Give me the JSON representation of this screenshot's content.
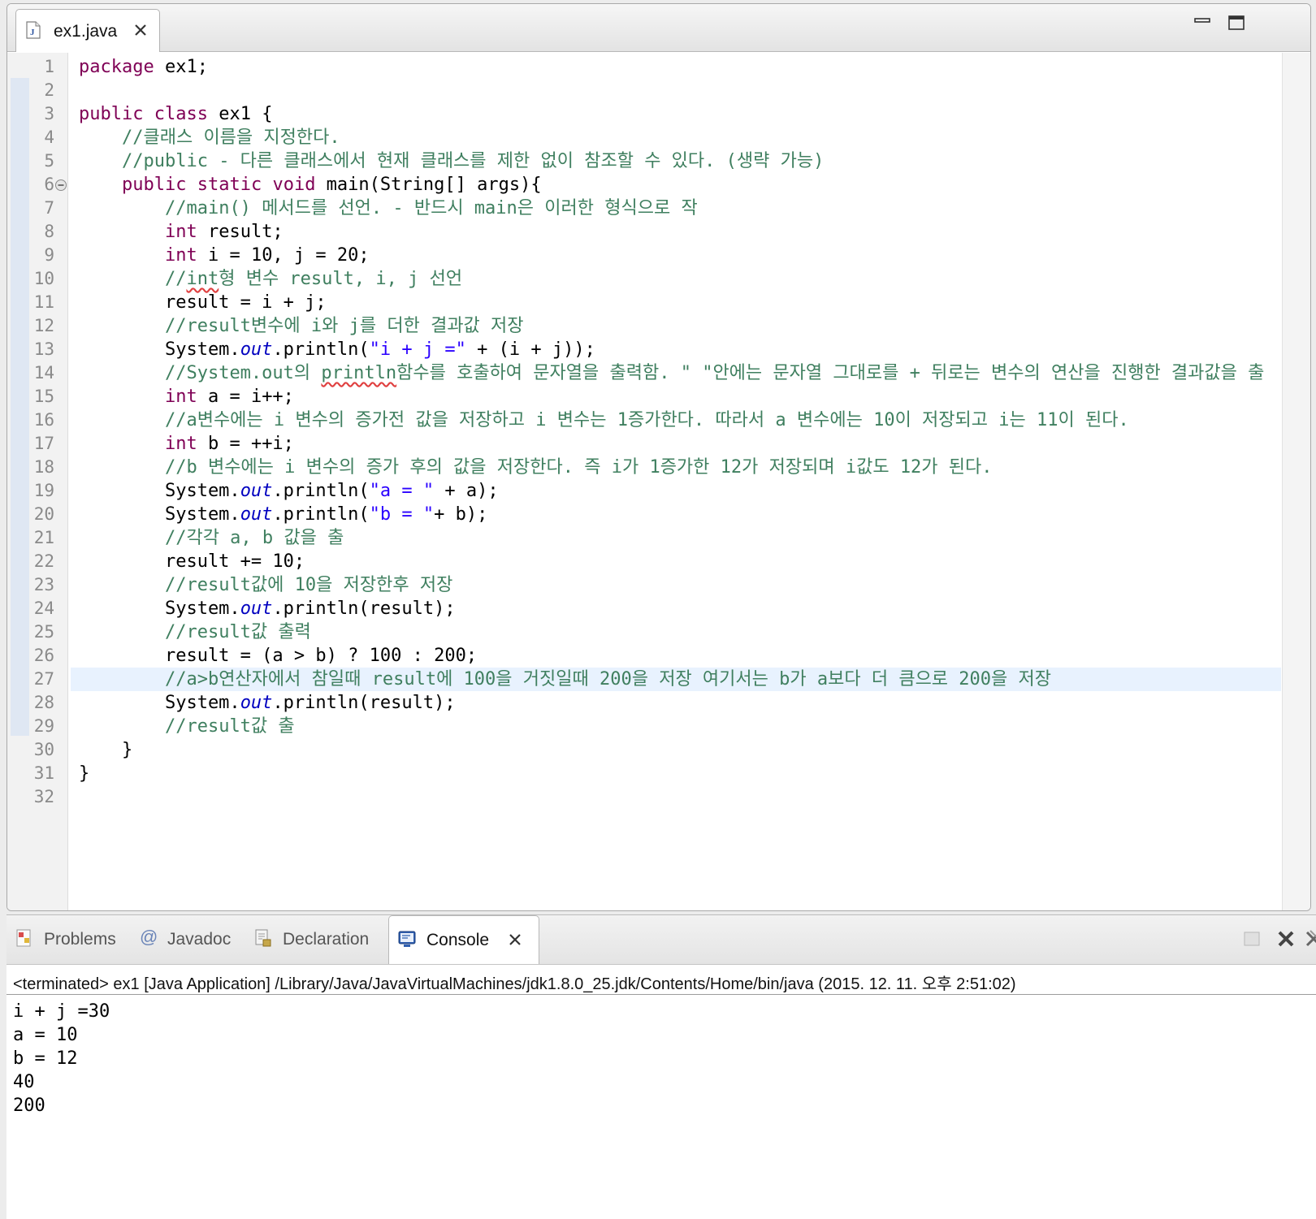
{
  "editor": {
    "tab": {
      "label": "ex1.java",
      "icon": "java-file-icon",
      "close_icon": "close-icon"
    },
    "window_controls": [
      "minimize-icon",
      "maximize-icon"
    ],
    "current_line": 27,
    "lines": [
      {
        "n": "1",
        "tokens": [
          {
            "t": "package",
            "c": "kw"
          },
          {
            "t": " ex1;"
          }
        ]
      },
      {
        "n": "2",
        "tokens": []
      },
      {
        "n": "3",
        "tokens": [
          {
            "t": "public",
            "c": "kw"
          },
          {
            "t": " "
          },
          {
            "t": "class",
            "c": "kw"
          },
          {
            "t": " ex1 {"
          }
        ]
      },
      {
        "n": "4",
        "tokens": [
          {
            "t": "    "
          },
          {
            "t": "//클래스 이름을 지정한다.",
            "c": "cm"
          }
        ]
      },
      {
        "n": "5",
        "tokens": [
          {
            "t": "    "
          },
          {
            "t": "//public - 다른 클래스에서 현재 클래스를 제한 없이 참조할 수 있다. (생략 가능)",
            "c": "cm"
          }
        ]
      },
      {
        "n": "6",
        "tokens": [
          {
            "t": "    "
          },
          {
            "t": "public",
            "c": "kw"
          },
          {
            "t": " "
          },
          {
            "t": "static",
            "c": "kw"
          },
          {
            "t": " "
          },
          {
            "t": "void",
            "c": "kw"
          },
          {
            "t": " main(String[] args){"
          }
        ]
      },
      {
        "n": "7",
        "tokens": [
          {
            "t": "        "
          },
          {
            "t": "//main() 메서드를 선언. - 반드시 main은 이러한 형식으로 작",
            "c": "cm"
          }
        ]
      },
      {
        "n": "8",
        "tokens": [
          {
            "t": "        "
          },
          {
            "t": "int",
            "c": "kw"
          },
          {
            "t": " result;"
          }
        ]
      },
      {
        "n": "9",
        "tokens": [
          {
            "t": "        "
          },
          {
            "t": "int",
            "c": "kw"
          },
          {
            "t": " i = 10, j = 20;"
          }
        ]
      },
      {
        "n": "10",
        "tokens": [
          {
            "t": "        "
          },
          {
            "t": "//",
            "c": "cm"
          },
          {
            "t": "int",
            "c": "cm sq"
          },
          {
            "t": "형 변수 result, i, j 선언",
            "c": "cm"
          }
        ]
      },
      {
        "n": "11",
        "tokens": [
          {
            "t": "        result = i + j;"
          }
        ]
      },
      {
        "n": "12",
        "tokens": [
          {
            "t": "        "
          },
          {
            "t": "//result변수에 i와 j를 더한 결과값 저장",
            "c": "cm"
          }
        ]
      },
      {
        "n": "13",
        "tokens": [
          {
            "t": "        System."
          },
          {
            "t": "out",
            "c": "fd"
          },
          {
            "t": ".println("
          },
          {
            "t": "\"i + j =\"",
            "c": "st"
          },
          {
            "t": " + (i + j));"
          }
        ]
      },
      {
        "n": "14",
        "tokens": [
          {
            "t": "        "
          },
          {
            "t": "//System.out의 ",
            "c": "cm"
          },
          {
            "t": "println",
            "c": "cm sq"
          },
          {
            "t": "함수를 호출하여 문자열을 출력함. \" \"안에는 문자열 그대로를 + 뒤로는 변수의 연산을 진행한 결과값을 출",
            "c": "cm"
          }
        ]
      },
      {
        "n": "15",
        "tokens": [
          {
            "t": "        "
          },
          {
            "t": "int",
            "c": "kw"
          },
          {
            "t": " a = i++;"
          }
        ]
      },
      {
        "n": "16",
        "tokens": [
          {
            "t": "        "
          },
          {
            "t": "//a변수에는 i 변수의 증가전 값을 저장하고 i 변수는 1증가한다. 따라서 a 변수에는 10이 저장되고 i는 11이 된다.",
            "c": "cm"
          }
        ]
      },
      {
        "n": "17",
        "tokens": [
          {
            "t": "        "
          },
          {
            "t": "int",
            "c": "kw"
          },
          {
            "t": " b = ++i;"
          }
        ]
      },
      {
        "n": "18",
        "tokens": [
          {
            "t": "        "
          },
          {
            "t": "//b 변수에는 i 변수의 증가 후의 값을 저장한다. 즉 i가 1증가한 12가 저장되며 i값도 12가 된다.",
            "c": "cm"
          }
        ]
      },
      {
        "n": "19",
        "tokens": [
          {
            "t": "        System."
          },
          {
            "t": "out",
            "c": "fd"
          },
          {
            "t": ".println("
          },
          {
            "t": "\"a = \"",
            "c": "st"
          },
          {
            "t": " + a);"
          }
        ]
      },
      {
        "n": "20",
        "tokens": [
          {
            "t": "        System."
          },
          {
            "t": "out",
            "c": "fd"
          },
          {
            "t": ".println("
          },
          {
            "t": "\"b = \"",
            "c": "st"
          },
          {
            "t": "+ b);"
          }
        ]
      },
      {
        "n": "21",
        "tokens": [
          {
            "t": "        "
          },
          {
            "t": "//각각 a, b 값을 출",
            "c": "cm"
          }
        ]
      },
      {
        "n": "22",
        "tokens": [
          {
            "t": "        result += 10;"
          }
        ]
      },
      {
        "n": "23",
        "tokens": [
          {
            "t": "        "
          },
          {
            "t": "//result값에 10을 저장한후 저장",
            "c": "cm"
          }
        ]
      },
      {
        "n": "24",
        "tokens": [
          {
            "t": "        System."
          },
          {
            "t": "out",
            "c": "fd"
          },
          {
            "t": ".println(result);"
          }
        ]
      },
      {
        "n": "25",
        "tokens": [
          {
            "t": "        "
          },
          {
            "t": "//result값 출력",
            "c": "cm"
          }
        ]
      },
      {
        "n": "26",
        "tokens": [
          {
            "t": "        result = (a > b) ? 100 : 200;"
          }
        ]
      },
      {
        "n": "27",
        "tokens": [
          {
            "t": "        "
          },
          {
            "t": "//a>b연산자에서 참일때 result에 100을 거짓일때 200을 저장 여기서는 b가 a보다 더 큼으로 200을 저장",
            "c": "cm"
          }
        ]
      },
      {
        "n": "28",
        "tokens": [
          {
            "t": "        System."
          },
          {
            "t": "out",
            "c": "fd"
          },
          {
            "t": ".println(result);"
          }
        ]
      },
      {
        "n": "29",
        "tokens": [
          {
            "t": "        "
          },
          {
            "t": "//result값 출",
            "c": "cm"
          }
        ]
      },
      {
        "n": "30",
        "tokens": [
          {
            "t": "    }"
          }
        ]
      },
      {
        "n": "31",
        "tokens": [
          {
            "t": "}"
          }
        ]
      },
      {
        "n": "32",
        "tokens": []
      }
    ]
  },
  "console": {
    "tabs": [
      {
        "label": "Problems",
        "icon": "problems-icon",
        "active": false
      },
      {
        "label": "Javadoc",
        "icon": "at-sign-icon",
        "active": false
      },
      {
        "label": "Declaration",
        "icon": "declaration-icon",
        "active": false
      },
      {
        "label": "Console",
        "icon": "console-icon",
        "active": true
      }
    ],
    "status": "<terminated> ex1 [Java Application] /Library/Java/JavaVirtualMachines/jdk1.8.0_25.jdk/Contents/Home/bin/java (2015. 12. 11. 오후 2:51:02)",
    "output": [
      "i + j =30",
      "a = 10",
      "b = 12",
      "40",
      "200"
    ],
    "actions": [
      "terminate-icon",
      "remove-launch-icon",
      "remove-all-terminated-icon"
    ]
  },
  "colors": {
    "keyword": "#7f0055",
    "comment": "#3f7f5f",
    "string": "#2a00ff",
    "field": "#0000c0",
    "current_line": "#e8f2fe"
  }
}
